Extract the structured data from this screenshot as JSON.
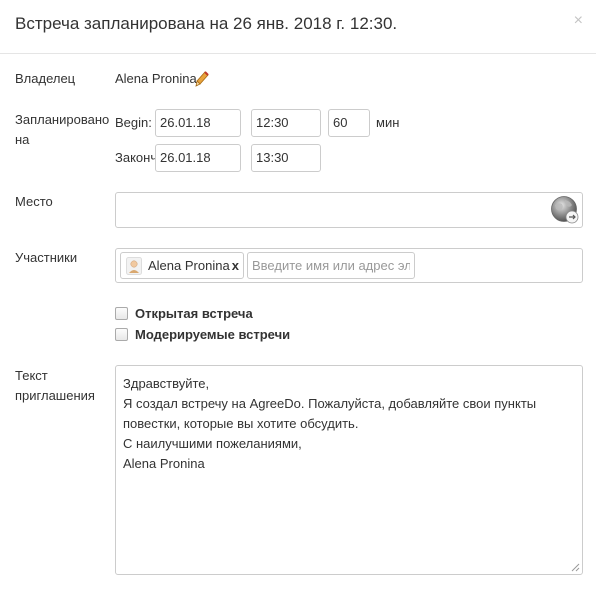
{
  "dialog": {
    "title": "Встреча запланирована на 26 янв. 2018 г. 12:30.",
    "close_glyph": "×"
  },
  "owner": {
    "label": "Владелец",
    "name": "Alena Pronina",
    "edit_icon": "pencil-icon"
  },
  "schedule": {
    "label_line1": "Запланировано",
    "label_line2": "на",
    "begin_label": "Begin:",
    "begin_date": "26.01.18",
    "begin_time": "12:30",
    "duration": "60",
    "duration_unit": "мин",
    "end_label": "Законч",
    "end_date": "26.01.18",
    "end_time": "13:30"
  },
  "place": {
    "label": "Место",
    "value": "",
    "icon": "globe-icon"
  },
  "participants": {
    "label": "Участники",
    "chips": [
      {
        "name": "Alena Pronina",
        "remove": "x",
        "icon": "user-avatar-icon"
      }
    ],
    "input_placeholder": "Введите имя или адрес эле"
  },
  "options": {
    "open_meeting": {
      "label": "Открытая встреча",
      "checked": false
    },
    "moderated": {
      "label": "Модерируемые встречи",
      "checked": false
    }
  },
  "invitation": {
    "label_line1": "Текст",
    "label_line2": "приглашения",
    "lines": [
      "Здравствуйте,",
      "Я создал встречу на AgreeDo. Пожалуйста, добавляйте свои пункты",
      "повестки, которые вы хотите обсудить.",
      "С наилучшими пожеланиями,",
      "Alena Pronina"
    ]
  },
  "colors": {
    "border": "#cccccc",
    "text": "#333333",
    "close": "#c4c4c4",
    "pencil": "#e8a33c"
  }
}
